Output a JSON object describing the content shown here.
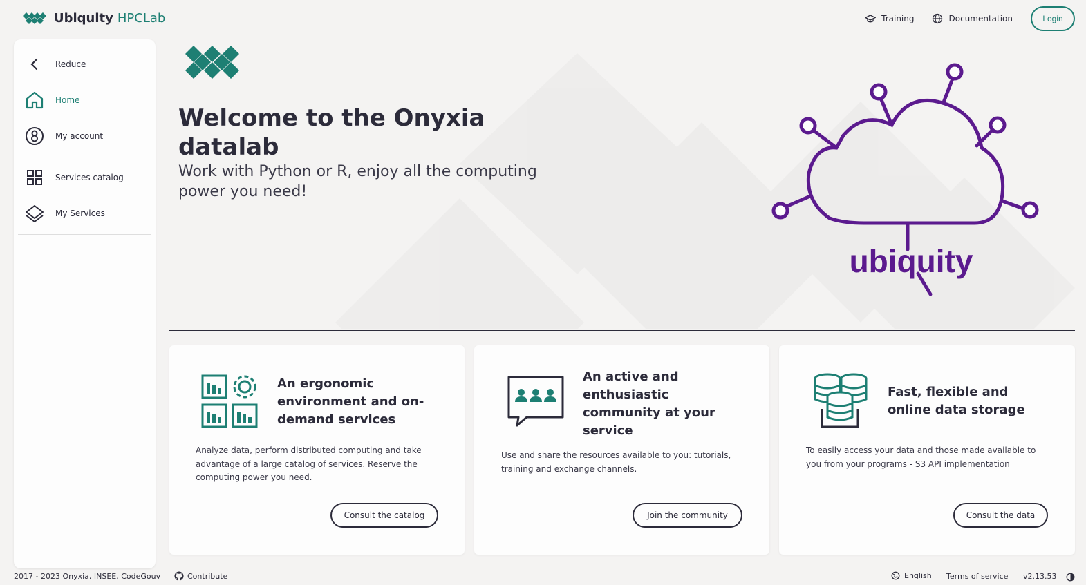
{
  "header": {
    "brand_name": "Ubiquity",
    "brand_sub": "HPCLab",
    "nav": [
      {
        "label": "Training",
        "icon": "graduation-cap-icon"
      },
      {
        "label": "Documentation",
        "icon": "globe-icon"
      }
    ],
    "login_label": "Login"
  },
  "sidebar": {
    "items": [
      {
        "label": "Reduce",
        "icon": "chevron-left-icon"
      },
      {
        "label": "Home",
        "icon": "home-icon",
        "active": true
      },
      {
        "label": "My account",
        "icon": "account-icon"
      },
      {
        "label": "Services catalog",
        "icon": "grid-icon"
      },
      {
        "label": "My Services",
        "icon": "layers-icon"
      }
    ]
  },
  "hero": {
    "title": "Welcome to the Onyxia datalab",
    "subtitle": "Work with Python or R, enjoy all the computing power you need!",
    "logo_text": "ubiquity"
  },
  "cards": [
    {
      "title": "An ergonomic environment and on-demand services",
      "text": "Analyze data, perform distributed computing and take advantage of a large catalog of services. Reserve the computing power you need.",
      "button": "Consult the catalog",
      "icon": "dashboard-gear-icon"
    },
    {
      "title": "An active and enthusiastic community at your service",
      "text": "Use and share the resources available to you: tutorials, training and exchange channels.",
      "button": "Join the community",
      "icon": "community-chat-icon"
    },
    {
      "title": "Fast, flexible and online data storage",
      "text": "To easily access your data and those made available to you from your programs - S3 API implementation",
      "button": "Consult the data",
      "icon": "database-icon"
    }
  ],
  "footer": {
    "copyright": "2017 - 2023 Onyxia, INSEE, CodeGouv",
    "contribute": "Contribute",
    "language": "English",
    "terms": "Terms of service",
    "version": "v2.13.53"
  },
  "colors": {
    "accent": "#1d7f73",
    "text": "#2c2b3a",
    "logo_purple": "#5b1a8e",
    "background": "#f4f3f2"
  }
}
